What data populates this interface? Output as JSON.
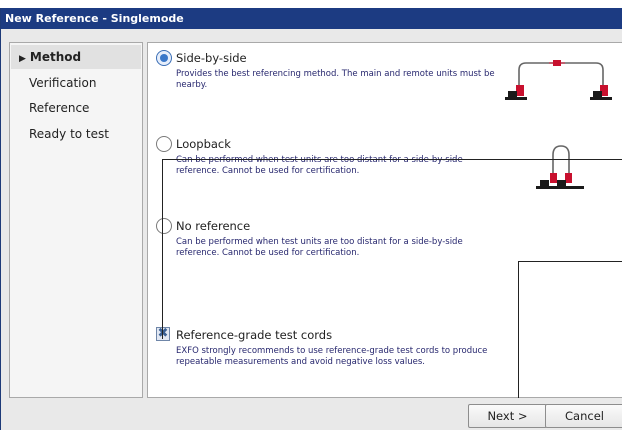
{
  "window": {
    "title": "New Reference - Singlemode"
  },
  "nav": {
    "items": [
      {
        "label": "Method",
        "active": true
      },
      {
        "label": "Verification",
        "active": false
      },
      {
        "label": "Reference",
        "active": false
      },
      {
        "label": "Ready to test",
        "active": false
      }
    ]
  },
  "options": {
    "side_by_side": {
      "label": "Side-by-side",
      "description": "Provides the best referencing method. The main and remote units must be nearby.",
      "selected": true
    },
    "loopback": {
      "label": "Loopback",
      "description": "Can be performed when test units are too distant for a side-by-side reference. Cannot be used for certification.",
      "selected": false
    },
    "no_reference": {
      "label": "No reference",
      "description": "Can be performed when test units are too distant for a side-by-side reference. Cannot be used for certification.",
      "selected": false
    }
  },
  "ref_grade": {
    "label": "Reference-grade test cords",
    "description": "EXFO strongly recommends to use reference-grade test cords to produce repeatable measurements and avoid negative loss values.",
    "checked": true
  },
  "buttons": {
    "next": "Next >",
    "cancel": "Cancel"
  },
  "icons": {
    "side_by_side_diagram": "two-units-connected-icon",
    "loopback_diagram": "loopback-unit-icon",
    "checkbox_mark": "x-mark-icon"
  },
  "colors": {
    "titlebar": "#1c3b82",
    "description_text": "#27276e",
    "radio_selected": "#3a78c9",
    "connector_accent": "#c8102e"
  }
}
